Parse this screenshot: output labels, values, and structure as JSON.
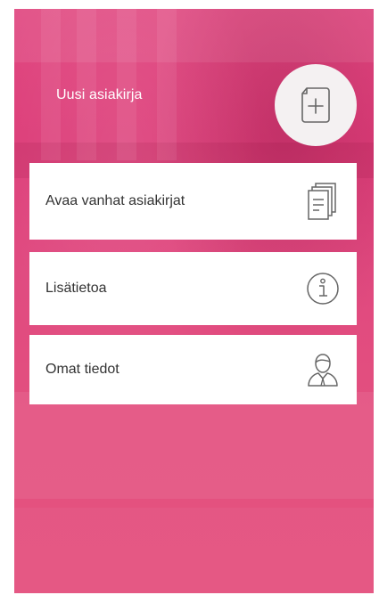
{
  "header": {
    "new_document_label": "Uusi asiakirja"
  },
  "menu": {
    "items": [
      {
        "label": "Avaa vanhat asiakirjat",
        "icon": "documents-icon"
      },
      {
        "label": "Lisätietoa",
        "icon": "info-icon"
      },
      {
        "label": "Omat tiedot",
        "icon": "user-icon"
      }
    ]
  },
  "colors": {
    "background": "#e0467f",
    "card": "#ffffff",
    "text": "#333333",
    "icon": "#666666"
  }
}
